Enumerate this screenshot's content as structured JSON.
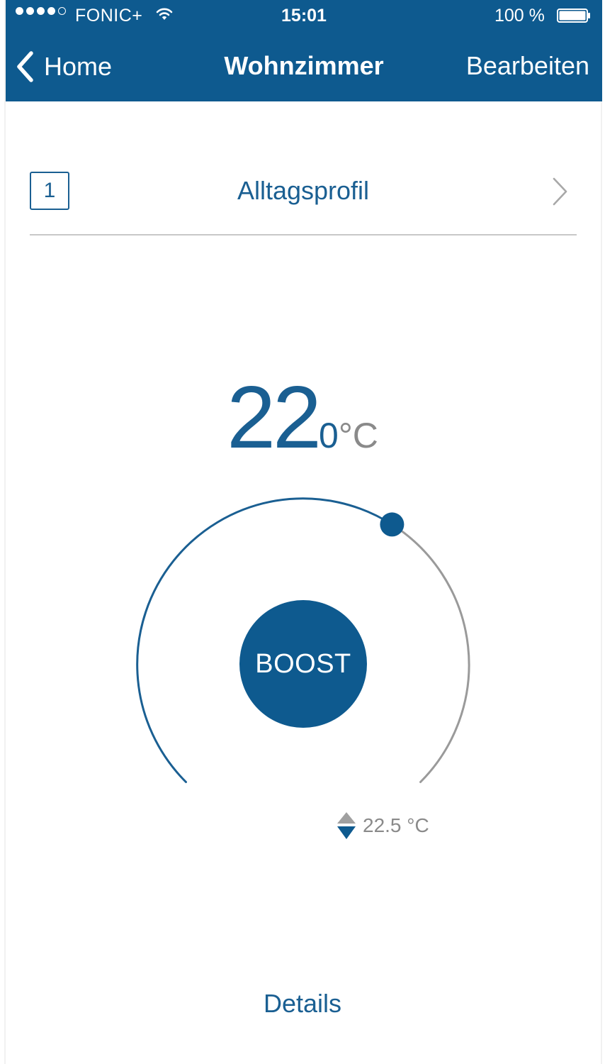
{
  "status_bar": {
    "carrier": "FONIC+",
    "signal_bars_filled": 4,
    "signal_bars_total": 5,
    "time": "15:01",
    "battery_percent": "100 %",
    "battery_level": 1.0
  },
  "nav": {
    "back_label": "Home",
    "title": "Wohnzimmer",
    "edit_label": "Bearbeiten"
  },
  "profile": {
    "number": "1",
    "name": "Alltagsprofil"
  },
  "target_temperature": {
    "integer": "22",
    "decimal": "0",
    "unit": "°C",
    "value": 22.0,
    "dial_level": 0.62
  },
  "boost": {
    "label": "BOOST"
  },
  "current_temperature": {
    "value": "22.5 °C"
  },
  "details": {
    "label": "Details"
  },
  "colors": {
    "primary": "#0e5a8f",
    "text_blue": "#1a5f92",
    "inactive_arc": "#9a9a9a",
    "divider": "#c8c8c8"
  },
  "icons": {
    "back": "chevron-left-icon",
    "profile_next": "chevron-right-icon",
    "current_temp": "up-down-arrows-icon",
    "wifi": "wifi-icon",
    "battery": "battery-icon"
  }
}
